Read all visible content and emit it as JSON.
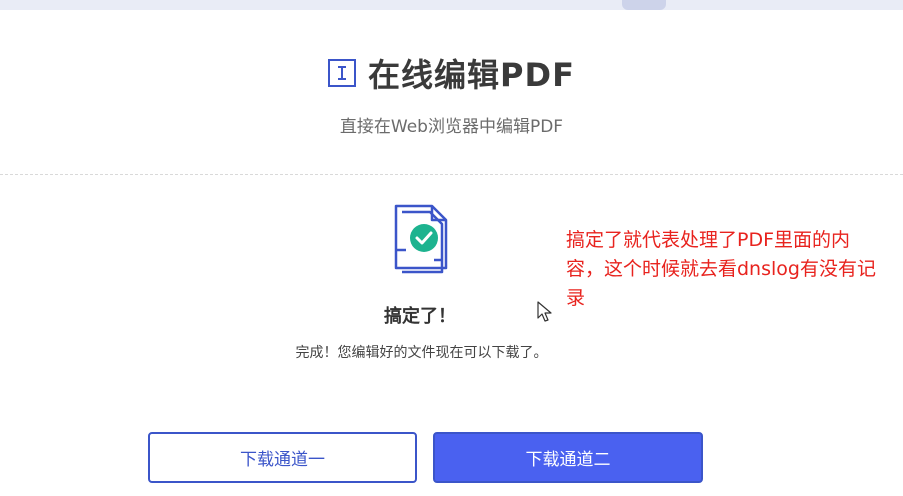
{
  "header": {
    "title": "在线编辑PDF",
    "subtitle": "直接在Web浏览器中编辑PDF",
    "icon": "text-cursor-icon"
  },
  "result": {
    "icon": "document-check-icon",
    "title": "搞定了！",
    "message": "完成！您编辑好的文件现在可以下载了。"
  },
  "annotation": {
    "text": "搞定了就代表处理了PDF里面的内容，这个时候就去看dnslog有没有记录",
    "color": "#e8231e"
  },
  "buttons": {
    "download_channel_1": "下载通道一",
    "download_channel_2": "下载通道二"
  },
  "colors": {
    "accent": "#3b55c9",
    "primary_button": "#4a61f0",
    "success": "#1db38f"
  }
}
